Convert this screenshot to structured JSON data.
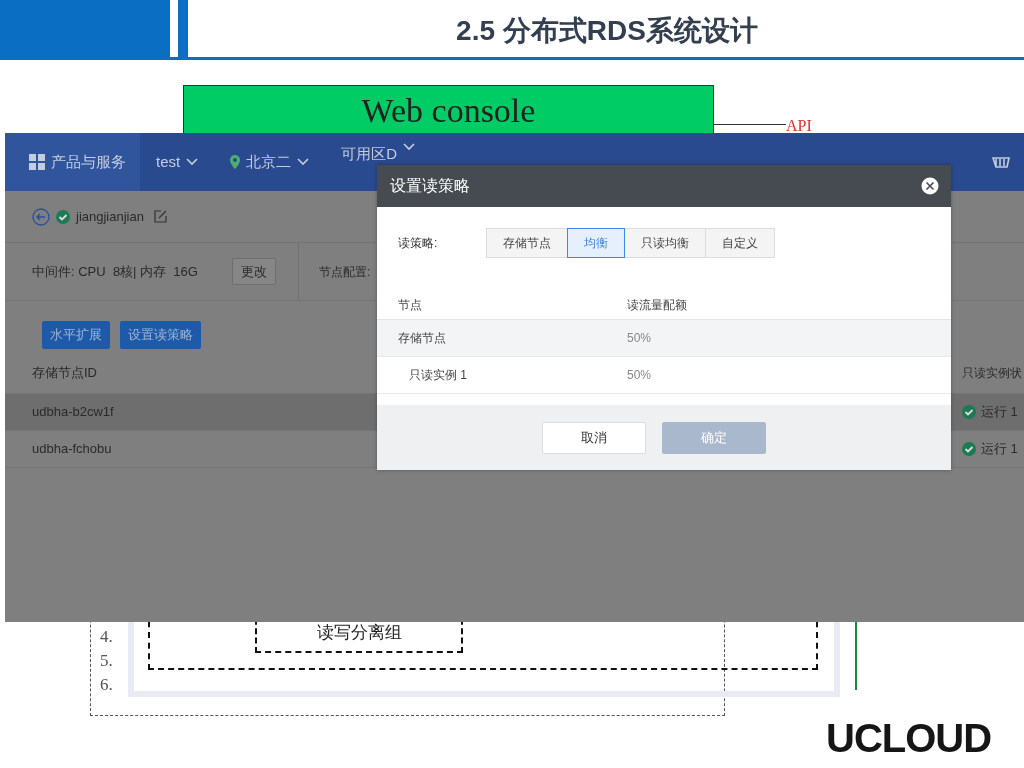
{
  "slide": {
    "title": "2.5 分布式RDS系统设计",
    "logo": "UCLOUD"
  },
  "diagram": {
    "web_console": "Web console",
    "api_label": "API",
    "line_numbers": [
      "4.",
      "5.",
      "6."
    ],
    "group_label": "读写分离组"
  },
  "screenshot": {
    "navbar": {
      "items": [
        {
          "kind": "menu",
          "label": "产品与服务"
        },
        {
          "kind": "dropdown",
          "label": "test"
        },
        {
          "kind": "location",
          "label": "北京二"
        },
        {
          "kind": "dropdown",
          "label": "可用区D"
        }
      ]
    },
    "instance": {
      "name": "jiangjianjian",
      "running": true
    },
    "spec": {
      "text": "中间件: CPU  8核| 内存  16G",
      "button": "更改",
      "node_config": "节点配置:"
    },
    "actions": [
      "水平扩展",
      "设置读策略"
    ],
    "table": {
      "columns": [
        "存储节点ID",
        "只读实例状"
      ],
      "rows": [
        {
          "id": "udbha-b2cw1f",
          "status": "运行 1",
          "running": true,
          "highlighted": true
        },
        {
          "id": "udbha-fchobu",
          "status": "运行 1",
          "running": true,
          "highlighted": false
        }
      ]
    }
  },
  "dialog": {
    "title": "设置读策略",
    "strategy_label": "读策略:",
    "options": [
      {
        "label": "存储节点",
        "selected": false
      },
      {
        "label": "均衡",
        "selected": true
      },
      {
        "label": "只读均衡",
        "selected": false
      },
      {
        "label": "自定义",
        "selected": false
      }
    ],
    "columns": [
      "节点",
      "读流量配额"
    ],
    "rows": [
      {
        "node": "存储节点",
        "quota": "50%",
        "highlighted": true,
        "children": [
          {
            "node": "只读实例 1",
            "quota": "50%",
            "highlighted": false
          }
        ]
      }
    ],
    "buttons": [
      {
        "label": "取消",
        "disabled": false
      },
      {
        "label": "确定",
        "disabled": true
      }
    ]
  }
}
